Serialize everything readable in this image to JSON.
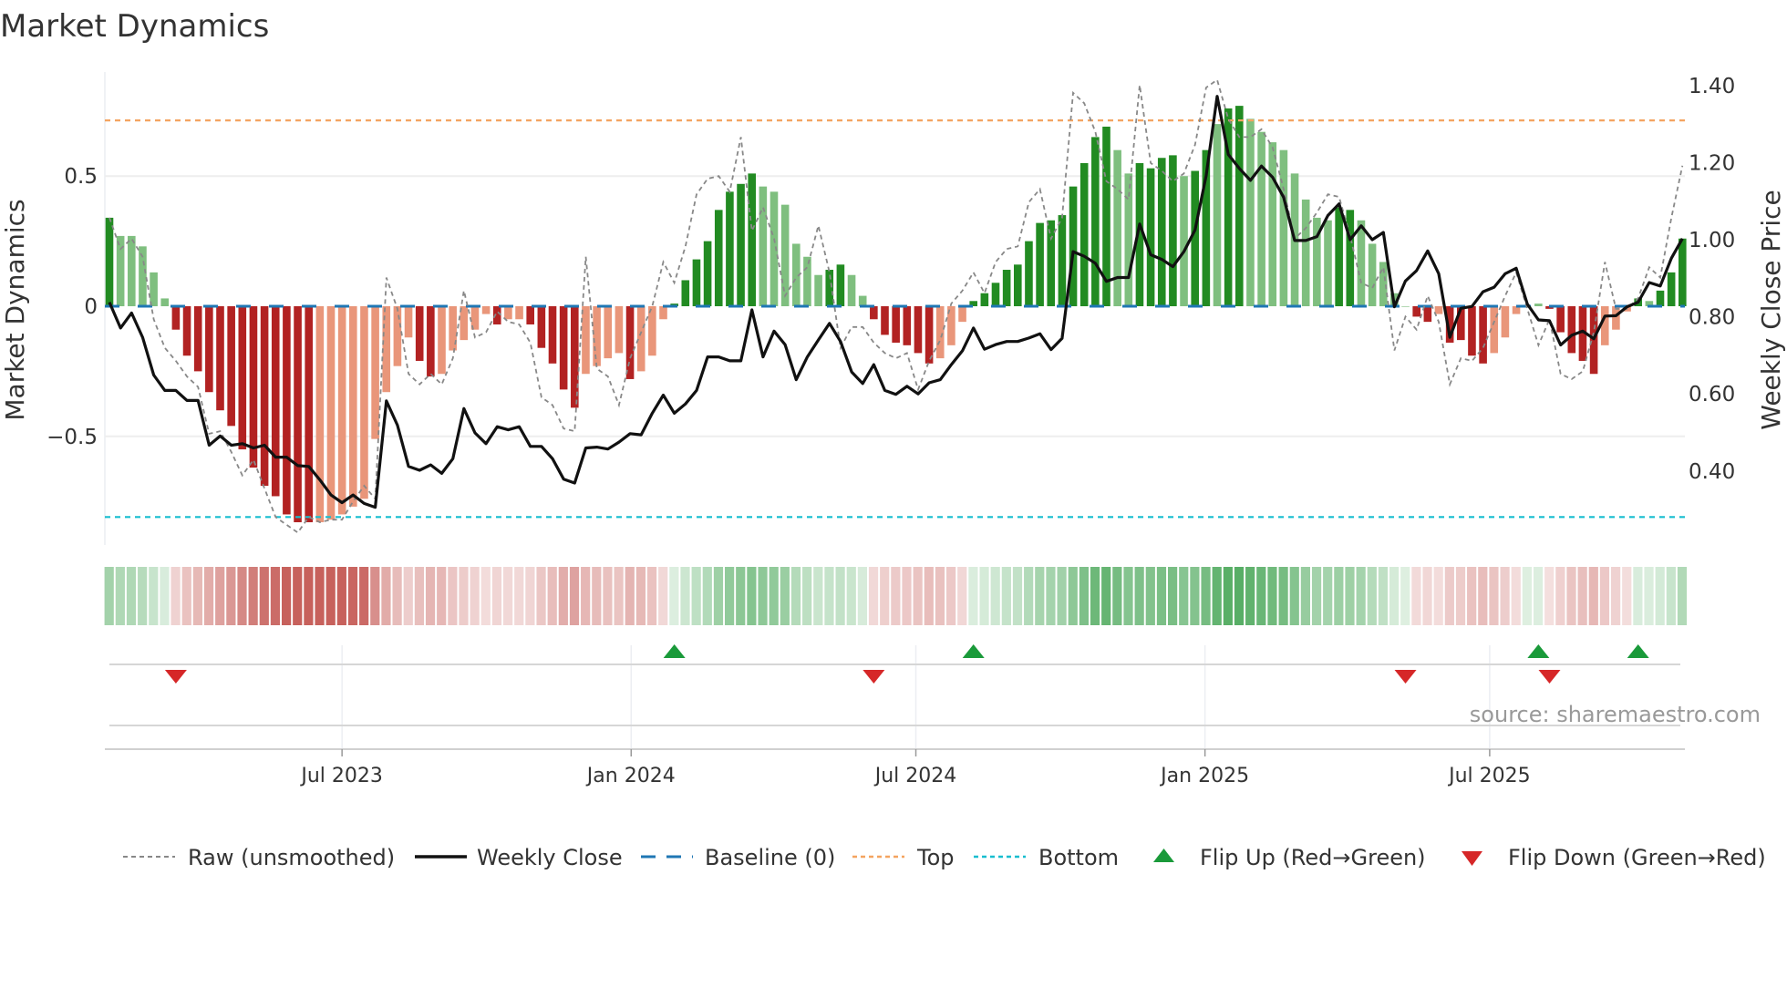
{
  "chart_data": {
    "type": "bar",
    "title": "Market Dynamics",
    "ylabel": "Market Dynamics",
    "y2label": "Weekly Close Price",
    "ylim": [
      -0.9,
      0.9
    ],
    "y2lim": [
      0.22,
      1.435
    ],
    "yticks": [
      {
        "v": 0.5,
        "label": "0.5"
      },
      {
        "v": 0,
        "label": "0"
      },
      {
        "v": -0.5,
        "label": "−0.5"
      }
    ],
    "y2ticks": [
      {
        "v": 1.4,
        "label": "1.40"
      },
      {
        "v": 1.2,
        "label": "1.20"
      },
      {
        "v": 1.0,
        "label": "1.00"
      },
      {
        "v": 0.8,
        "label": "0.80"
      },
      {
        "v": 0.6,
        "label": "0.60"
      },
      {
        "v": 0.4,
        "label": "0.40"
      }
    ],
    "xticks": [
      {
        "week": 21,
        "label": "Jul 2023"
      },
      {
        "week": 47.1,
        "label": "Jan 2024"
      },
      {
        "week": 72.8,
        "label": "Jul 2024"
      },
      {
        "week": 98.9,
        "label": "Jan 2025"
      },
      {
        "week": 124.6,
        "label": "Jul 2025"
      }
    ],
    "grid": true,
    "legend_position": "bottom",
    "levels": {
      "baseline": 0,
      "top": 0.714,
      "bottom": -0.81
    },
    "colors": {
      "green_strong": "#228b22",
      "green_weak": "#7fbf7f",
      "red_strong": "#b22222",
      "red_weak": "#e9967a",
      "price": "#111111",
      "raw": "#888888",
      "baseline": "#1f77b4",
      "top": "#f4a460",
      "bottom": "#17becf",
      "flip_up": "#1a9a3a",
      "flip_down": "#d62728"
    },
    "momentum": [
      0.34,
      0.27,
      0.27,
      0.23,
      0.13,
      0.03,
      -0.09,
      -0.19,
      -0.25,
      -0.33,
      -0.4,
      -0.46,
      -0.55,
      -0.62,
      -0.69,
      -0.73,
      -0.8,
      -0.83,
      -0.83,
      -0.83,
      -0.82,
      -0.8,
      -0.77,
      -0.74,
      -0.51,
      -0.33,
      -0.23,
      -0.12,
      -0.21,
      -0.27,
      -0.26,
      -0.17,
      -0.13,
      -0.09,
      -0.03,
      -0.07,
      -0.05,
      -0.05,
      -0.07,
      -0.16,
      -0.22,
      -0.32,
      -0.39,
      -0.26,
      -0.23,
      -0.2,
      -0.18,
      -0.28,
      -0.25,
      -0.19,
      -0.05,
      0.01,
      0.1,
      0.18,
      0.25,
      0.37,
      0.44,
      0.47,
      0.51,
      0.46,
      0.44,
      0.39,
      0.24,
      0.19,
      0.12,
      0.14,
      0.16,
      0.12,
      0.04,
      -0.05,
      -0.11,
      -0.14,
      -0.15,
      -0.18,
      -0.22,
      -0.2,
      -0.15,
      -0.06,
      0.02,
      0.05,
      0.09,
      0.14,
      0.16,
      0.25,
      0.32,
      0.33,
      0.35,
      0.46,
      0.55,
      0.65,
      0.69,
      0.6,
      0.51,
      0.55,
      0.53,
      0.57,
      0.58,
      0.5,
      0.52,
      0.6,
      0.7,
      0.76,
      0.77,
      0.72,
      0.67,
      0.63,
      0.6,
      0.51,
      0.41,
      0.34,
      0.33,
      0.38,
      0.37,
      0.33,
      0.24,
      0.17,
      0.05,
      0.0,
      -0.04,
      -0.06,
      -0.03,
      -0.14,
      -0.13,
      -0.19,
      -0.22,
      -0.18,
      -0.12,
      -0.03,
      0.0,
      0.01,
      -0.01,
      -0.1,
      -0.18,
      -0.21,
      -0.26,
      -0.15,
      -0.09,
      -0.02,
      0.03,
      0.02,
      0.06,
      0.13,
      0.26
    ],
    "strong": [
      1,
      0,
      0,
      0,
      0,
      0,
      1,
      1,
      1,
      1,
      1,
      1,
      1,
      1,
      1,
      1,
      1,
      1,
      1,
      0,
      0,
      0,
      0,
      0,
      0,
      0,
      0,
      0,
      1,
      1,
      0,
      0,
      0,
      0,
      0,
      1,
      0,
      0,
      1,
      1,
      1,
      1,
      1,
      0,
      0,
      0,
      0,
      1,
      0,
      0,
      0,
      1,
      1,
      1,
      1,
      1,
      1,
      1,
      1,
      0,
      0,
      0,
      0,
      0,
      0,
      1,
      1,
      0,
      0,
      1,
      1,
      1,
      1,
      1,
      1,
      0,
      0,
      0,
      1,
      1,
      1,
      1,
      1,
      1,
      1,
      1,
      1,
      1,
      1,
      1,
      1,
      0,
      0,
      1,
      1,
      1,
      1,
      0,
      1,
      1,
      0,
      1,
      1,
      0,
      0,
      0,
      0,
      0,
      0,
      0,
      0,
      1,
      1,
      0,
      0,
      0,
      0,
      0,
      1,
      1,
      0,
      1,
      1,
      1,
      1,
      0,
      0,
      0,
      0,
      0,
      1,
      1,
      1,
      1,
      1,
      0,
      0,
      0,
      1,
      0,
      1,
      1,
      1
    ],
    "raw": [
      0.34,
      0.22,
      0.26,
      0.19,
      -0.05,
      -0.16,
      -0.21,
      -0.27,
      -0.31,
      -0.49,
      -0.48,
      -0.56,
      -0.65,
      -0.59,
      -0.7,
      -0.81,
      -0.84,
      -0.87,
      -0.81,
      -0.83,
      -0.82,
      -0.82,
      -0.75,
      -0.69,
      -0.74,
      0.11,
      -0.01,
      -0.26,
      -0.3,
      -0.26,
      -0.3,
      -0.2,
      0.06,
      -0.12,
      -0.1,
      -0.02,
      -0.06,
      -0.07,
      -0.14,
      -0.35,
      -0.38,
      -0.47,
      -0.48,
      0.19,
      -0.24,
      -0.27,
      -0.38,
      -0.2,
      -0.1,
      0.0,
      0.17,
      0.09,
      0.23,
      0.43,
      0.49,
      0.5,
      0.44,
      0.65,
      0.29,
      0.38,
      0.26,
      0.04,
      0.11,
      0.15,
      0.31,
      0.13,
      -0.16,
      -0.08,
      -0.08,
      -0.14,
      -0.18,
      -0.2,
      -0.18,
      -0.32,
      -0.21,
      -0.13,
      0.01,
      0.06,
      0.13,
      0.05,
      0.17,
      0.22,
      0.23,
      0.4,
      0.45,
      0.26,
      0.34,
      0.82,
      0.78,
      0.67,
      0.48,
      0.45,
      0.41,
      0.85,
      0.55,
      0.52,
      0.48,
      0.51,
      0.62,
      0.84,
      0.87,
      0.72,
      0.65,
      0.65,
      0.68,
      0.61,
      0.45,
      0.26,
      0.3,
      0.36,
      0.43,
      0.42,
      0.27,
      0.09,
      0.07,
      0.15,
      -0.17,
      -0.04,
      -0.09,
      0.04,
      -0.06,
      -0.3,
      -0.2,
      -0.21,
      -0.16,
      -0.06,
      0.04,
      0.13,
      -0.01,
      -0.15,
      -0.05,
      -0.26,
      -0.28,
      -0.25,
      -0.1,
      0.17,
      -0.01,
      -0.01,
      0.03,
      0.15,
      0.11,
      0.34,
      0.54
    ],
    "weekly_close": [
      0.838,
      0.771,
      0.81,
      0.747,
      0.649,
      0.609,
      0.609,
      0.583,
      0.583,
      0.467,
      0.491,
      0.467,
      0.471,
      0.46,
      0.467,
      0.436,
      0.436,
      0.414,
      0.412,
      0.377,
      0.338,
      0.318,
      0.338,
      0.316,
      0.306,
      0.582,
      0.519,
      0.412,
      0.402,
      0.416,
      0.394,
      0.432,
      0.562,
      0.499,
      0.471,
      0.515,
      0.507,
      0.515,
      0.464,
      0.464,
      0.432,
      0.379,
      0.369,
      0.46,
      0.462,
      0.457,
      0.475,
      0.497,
      0.494,
      0.55,
      0.597,
      0.55,
      0.574,
      0.609,
      0.696,
      0.696,
      0.686,
      0.686,
      0.818,
      0.696,
      0.763,
      0.728,
      0.637,
      0.696,
      0.74,
      0.783,
      0.736,
      0.657,
      0.627,
      0.676,
      0.609,
      0.599,
      0.62,
      0.6,
      0.629,
      0.637,
      0.676,
      0.712,
      0.771,
      0.716,
      0.728,
      0.736,
      0.736,
      0.745,
      0.756,
      0.715,
      0.744,
      0.969,
      0.957,
      0.939,
      0.892,
      0.902,
      0.902,
      1.041,
      0.961,
      0.949,
      0.93,
      0.969,
      1.025,
      1.166,
      1.372,
      1.221,
      1.185,
      1.154,
      1.191,
      1.162,
      1.11,
      0.998,
      0.998,
      1.008,
      1.063,
      1.093,
      1.0,
      1.036,
      1.0,
      1.019,
      0.826,
      0.893,
      0.92,
      0.971,
      0.912,
      0.747,
      0.822,
      0.827,
      0.865,
      0.877,
      0.912,
      0.926,
      0.833,
      0.792,
      0.79,
      0.727,
      0.752,
      0.763,
      0.743,
      0.802,
      0.803,
      0.826,
      0.838,
      0.889,
      0.88,
      0.952,
      1.003
    ],
    "flip_up_weeks": [
      51,
      78,
      129,
      138
    ],
    "flip_down_weeks": [
      6,
      69,
      117,
      130
    ]
  },
  "legend": {
    "items": [
      {
        "label": "Raw (unsmoothed)"
      },
      {
        "label": "Weekly Close"
      },
      {
        "label": "Baseline (0)"
      },
      {
        "label": "Top"
      },
      {
        "label": "Bottom"
      },
      {
        "label": "Flip Up (Red→Green)"
      },
      {
        "label": "Flip Down (Green→Red)"
      }
    ]
  },
  "source": "source: sharemaestro.com"
}
